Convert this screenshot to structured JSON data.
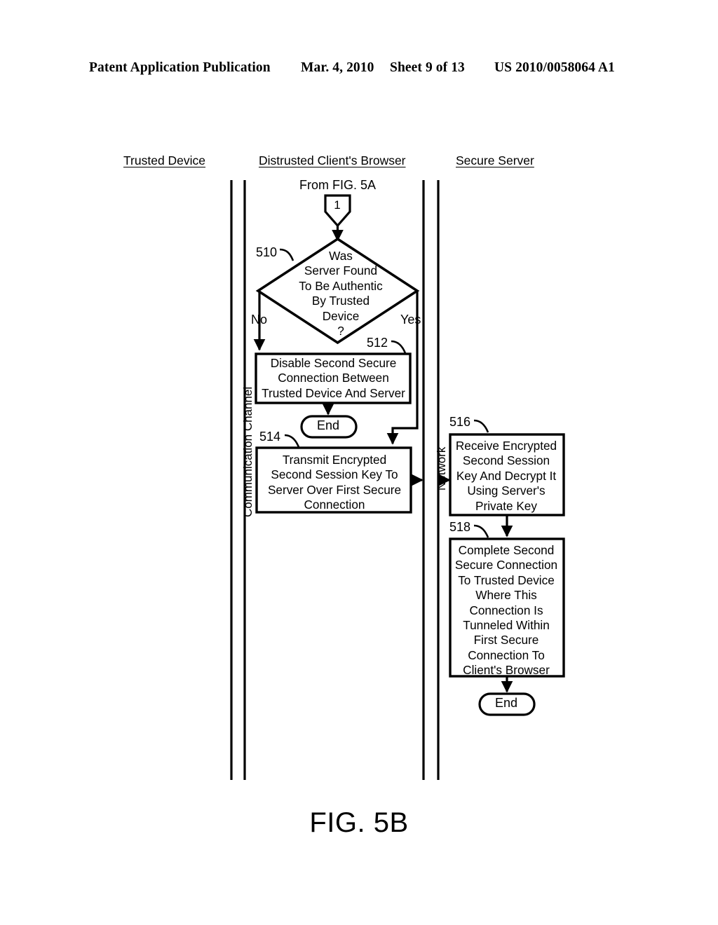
{
  "header": {
    "publication": "Patent Application Publication",
    "date": "Mar. 4, 2010",
    "sheet": "Sheet 9 of 13",
    "number": "US 2010/0058064 A1"
  },
  "figure": {
    "caption": "FIG. 5B",
    "lanes": [
      {
        "id": "trusted-device",
        "title": "Trusted Device"
      },
      {
        "id": "distrusted-client-browser",
        "title": "Distrusted Client's Browser"
      },
      {
        "id": "secure-server",
        "title": "Secure Server"
      }
    ],
    "lane_dividers": [
      {
        "id": "communication-channel",
        "label": "Communication Channel"
      },
      {
        "id": "network",
        "label": "Network"
      }
    ],
    "entry_label": "From FIG. 5A",
    "connector": {
      "id": "connector-1",
      "label": "1"
    },
    "nodes": [
      {
        "ref": "510",
        "type": "decision",
        "text": "Was\nServer Found\nTo Be Authentic\nBy Trusted\nDevice\n?"
      },
      {
        "ref": "512",
        "type": "process",
        "text": "Disable Second Secure\nConnection Between\nTrusted Device And Server"
      },
      {
        "ref": "514",
        "type": "process",
        "text": "Transmit Encrypted\nSecond Session Key To\nServer Over First Secure\nConnection"
      },
      {
        "ref": "516",
        "type": "process",
        "text": "Receive Encrypted\nSecond Session\nKey And Decrypt It\nUsing Server's\nPrivate Key"
      },
      {
        "ref": "518",
        "type": "process",
        "text": "Complete Second\nSecure Connection\nTo Trusted Device\nWhere This\nConnection Is\nTunneled Within\nFirst Secure\nConnection To\nClient's Browser"
      }
    ],
    "terminators": [
      {
        "id": "end-after-512",
        "label": "End"
      },
      {
        "id": "end-after-518",
        "label": "End"
      }
    ],
    "branch_labels": {
      "no": "No",
      "yes": "Yes"
    },
    "colors": {
      "ink": "#000000",
      "background": "#ffffff"
    }
  }
}
